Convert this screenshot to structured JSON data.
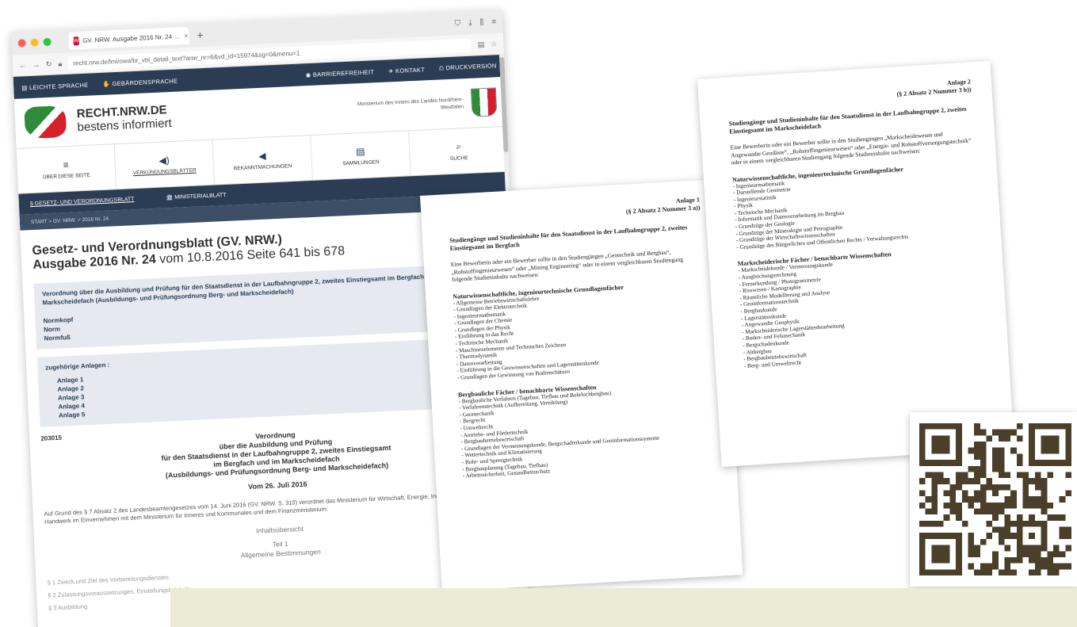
{
  "browser": {
    "tab_title": "GV. NRW. Ausgabe 2016 Nr. 24 …",
    "tab_close": "×",
    "new_tab": "+",
    "url": "recht.nrw.de/lmi/owa/br_vbl_detail_text?anw_nr=6&vd_id=15974&sg=0&menu=1",
    "toolbar_icons": [
      "shield-icon",
      "download-icon",
      "library-icon",
      "menu-icon"
    ],
    "nav_icons": [
      "back-icon",
      "forward-icon",
      "reload-icon"
    ]
  },
  "site": {
    "top_nav": {
      "easy_language": "LEICHTE SPRACHE",
      "sign_language": "GEBÄRDENSPRACHE",
      "accessibility": "BARRIEREFREIHEIT",
      "contact": "KONTAKT",
      "print": "DRUCKVERSION"
    },
    "brand_line1": "RECHT.NRW.DE",
    "brand_line2": "bestens informiert",
    "ministry": "Ministerium des Innern des Landes Nordrhein-Westfalen",
    "icon_nav": [
      {
        "label": "ÜBER DIESE SEITE",
        "icon": "≡"
      },
      {
        "label": "VERKÜNDUNGSBLÄTTER",
        "icon": "◀)"
      },
      {
        "label": "BEKANNTMACHUNGEN",
        "icon": "◀"
      },
      {
        "label": "SAMMLUNGEN",
        "icon": "▤"
      },
      {
        "label": "SUCHE",
        "icon": "⌕"
      }
    ],
    "sub_nav": {
      "gv": "GESETZ- UND VERORDNUNGSBLATT",
      "mbl": "MINISTERIALBLATT"
    },
    "breadcrumb": "START  >  GV. NRW.  >  2016 Nr. 24"
  },
  "content": {
    "title_line1": "Gesetz- und Verordnungsblatt (GV. NRW.)",
    "title_line2_bold": "Ausgabe 2016 Nr. 24",
    "title_line2_rest": " vom 10.8.2016 Seite 641 bis 678",
    "box_title": "Verordnung über die Ausbildung und Prüfung für den Staatsdienst in der Laufbahngruppe 2, zweites Einstiegsamt im Bergfach und im Markscheidefach (Ausbildungs- und Prüfungsordnung Berg- und Markscheidefach)",
    "box_items": [
      "Normkopf",
      "Norm",
      "Normfuß"
    ],
    "annexes_title": "zugehörige Anlagen :",
    "annexes": [
      "Anlage 1",
      "Anlage 2",
      "Anlage 3",
      "Anlage 4",
      "Anlage 5"
    ],
    "law_number": "203015",
    "decree_lines": [
      "Verordnung",
      "über die Ausbildung und Prüfung",
      "für den Staatsdienst in der Laufbahngruppe 2, zweites Einstiegsamt",
      "im Bergfach und im Markscheidefach",
      "(Ausbildungs- und Prüfungsordnung Berg- und Markscheidefach)"
    ],
    "decree_date": "Vom 26. Juli 2016",
    "paragraph": "Auf Grund des § 7 Absatz 2 des Landesbeamtengesetzes vom 14. Juni 2016 (GV. NRW. S. 310) verordnet das Ministerium für Wirtschaft, Energie, Industrie, Mittelstand und Handwerk im Einvernehmen mit dem Ministerium für Inneres und Kommunales und dem Finanzministerium:",
    "toc_title": "Inhaltsübersicht",
    "toc_part": "Teil 1",
    "toc_part_title": "Allgemeine Bestimmungen",
    "sections": [
      "§ 1   Zweck und Ziel des Vorbereitungsdienstes",
      "§ 2   Zulassungsvoraussetzungen, Einstellungsbehörde",
      "§ 3   Ausbildung"
    ]
  },
  "page1": {
    "annex": "Anlage 1",
    "ref": "(§ 2 Absatz 2 Nummer 3 a))",
    "title": "Studiengänge und Studieninhalte für den Staatsdienst in der Laufbahngruppe 2, zweites Einstiegsamt im Bergfach",
    "intro": "Eine Bewerberin oder ein Bewerber sollte in den Studiengängen „Geotechnik und Bergbau“, „Rohstoffingenieurwesen“ oder „Mining Engineering“ oder in einem vergleichbaren Studiengang folgende Studieninhalte nachweisen:",
    "section1": "Naturwissenschaftliche, ingenieurtechnische Grundlagenfächer",
    "items1": [
      "- Allgemeine Betriebswirtschaftslehre",
      "- Grundlagen der Elektrotechnik",
      "- Ingenieurmathematik",
      "- Grundlagen der Chemie",
      "- Grundlagen der Physik",
      "- Einführung in das Recht",
      "- Technische Mechanik",
      "- Maschinenelemente und Technisches Zeichnen",
      "- Thermodynamik",
      "- Datenverarbeitung",
      "- Einführung in die Geowissenschaften und Lagerstättenkunde",
      "- Grundlagen der Gewinnung von Bodenschätzen"
    ],
    "section2": "Bergbauliche Fächer / benachbarte Wissenschaften",
    "items2": [
      "- Bergbauliche Verfahren (Tagebau, Tiefbau und Bohrlochbergbau)",
      "- Verfahrenstechnik (Aufbereitung, Veredelung)",
      "- Geomechanik",
      "- Bergrecht",
      "- Umweltrecht",
      "- Antriebs- und Fördertechnik",
      "- Bergbaubetriebswirtschaft",
      "- Grundlagen der Vermessungskunde, Bergschadenkunde und Geoinformationssysteme",
      "- Wettertechnik und Klimatisierung",
      "- Bohr- und Sprengtechnik",
      "- Bergbauplanung (Tagebau, Tiefbau)",
      "- Arbeitssicherheit, Gesundheitsschutz"
    ]
  },
  "page2": {
    "annex": "Anlage 2",
    "ref": "(§ 2 Absatz 2 Nummer 3 b))",
    "title": "Studiengänge und Studieninhalte für den Staatsdienst in der Laufbahngruppe 2, zweites Einstiegsamt im Markscheidefach",
    "intro": "Eine Bewerberin oder ein Bewerber sollte in den Studiengängen „Markscheidewesen und Angewandte Geodäsie“, „Rohstoffingenieurwesen“ oder „Energie- und Rohstoffversorgungstechnik“ oder in einem vergleichbaren Studiengang folgende Studieninhalte nachweisen:",
    "section1": "Naturwissenschaftliche, ingenieurtechnische Grundlagenfächer",
    "items1": [
      "- Ingenieurmathematik",
      "- Darstellende Geometrie",
      "- Ingenieurstatistik",
      "- Physik",
      "- Technische Mechanik",
      "- Informatik und Datenverarbeitung im Bergbau",
      "- Grundzüge der Geologie",
      "- Grundzüge der Mineralogie und Petrographie",
      "- Grundzüge der Wirtschaftswissenschaften",
      "- Grundzüge des Bürgerlichen und Öffentlichen Rechts / Verwaltungsrechts"
    ],
    "section2": "Markscheiderische Fächer / benachbarte Wissenschaften",
    "items2": [
      "- Markscheidekunde / Vermessungskunde",
      "- Ausgleichungsrechnung",
      "- Fernerkundung / Photogrammetrie",
      "- Risswesen / Kartographie",
      "- Räumliche Modellierung und Analyse",
      "- Geoinformationstechnik",
      "- Bergbaukunde",
      "- Lagerstättenkunde",
      "- Angewandte Geophysik",
      "- Markscheiderische Lagerstättenbearbeitung",
      "- Boden- und Felsmechanik",
      "- Bergschadenkunde",
      "- Altbergbau",
      "- Bergbaubetriebswirtschaft",
      "- Berg- und Umweltrecht"
    ]
  },
  "colors": {
    "nav_dark": "#2b3d55",
    "box_bg": "#e6eaf0",
    "band": "#ecebd4",
    "qr_dark": "#4a3f2a"
  }
}
